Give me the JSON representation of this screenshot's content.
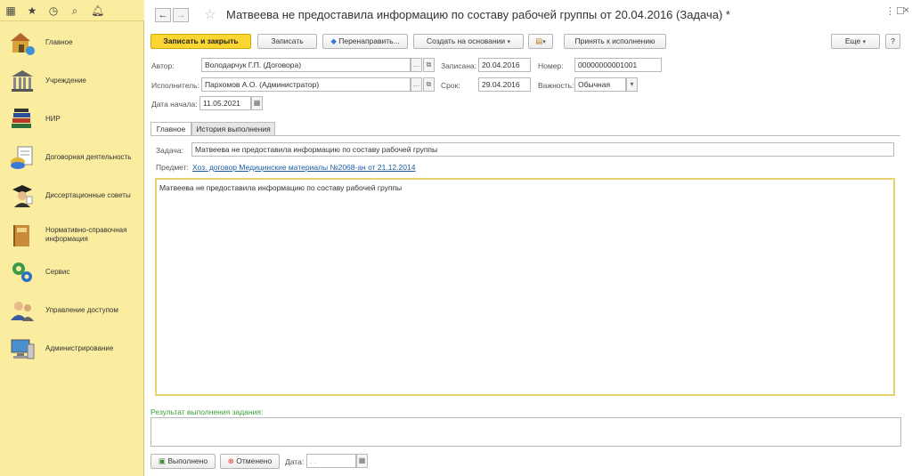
{
  "topbar": {
    "icons": [
      "apps-grid-icon",
      "star-icon",
      "history-icon",
      "search-icon",
      "bell-icon"
    ]
  },
  "sidebar": {
    "items": [
      {
        "label": "Главное",
        "icon": "home-icon"
      },
      {
        "label": "Учреждение",
        "icon": "institution-icon"
      },
      {
        "label": "НИР",
        "icon": "books-icon"
      },
      {
        "label": "Договорная деятельность",
        "icon": "contracts-icon"
      },
      {
        "label": "Диссертационные советы",
        "icon": "graduate-icon"
      },
      {
        "label": "Нормативно-справочная информация",
        "icon": "reference-book-icon"
      },
      {
        "label": "Сервис",
        "icon": "service-gears-icon"
      },
      {
        "label": "Управление доступом",
        "icon": "users-icon"
      },
      {
        "label": "Администрирование",
        "icon": "admin-computer-icon"
      }
    ]
  },
  "header": {
    "title": "Матвеева не предоставила информацию по составу рабочей группы от 20.04.2016 (Задача) *",
    "back": "←",
    "forward": "→",
    "star": "☆"
  },
  "toolbar": {
    "save_close": "Записать и закрыть",
    "save": "Записать",
    "redirect": "Перенаправить...",
    "create_based": "Создать на основании",
    "accept": "Принять к исполнению",
    "more": "Еще",
    "help": "?"
  },
  "form": {
    "author_label": "Автор:",
    "author_value": "Володарчук Г.П. (Договора)",
    "recorded_label": "Записана:",
    "recorded_value": "20.04.2016",
    "number_label": "Номер:",
    "number_value": "00000000001001",
    "executor_label": "Исполнитель:",
    "executor_value": "Пархомов А.О. (Администратор)",
    "deadline_label": "Срок:",
    "deadline_value": "29.04.2016",
    "importance_label": "Важность:",
    "importance_value": "Обычная",
    "start_label": "Дата начала:",
    "start_value": "11.05.2021"
  },
  "tabs": [
    {
      "label": "Главное",
      "active": true
    },
    {
      "label": "История выполнения",
      "active": false
    }
  ],
  "main": {
    "task_label": "Задача:",
    "task_value": "Матвеева не предоставила информацию по составу рабочей группы",
    "subject_label": "Предмет:",
    "subject_link": "Хоз. договор Медицинские материалы №2068-ан от 21.12.2014",
    "description": "Матвеева не предоставила информацию по составу рабочей группы",
    "result_label": "Результат выполнения задания:"
  },
  "footer": {
    "done": "Выполнено",
    "cancelled": "Отменено",
    "date_label": "Дата:",
    "date_placeholder": "  .  ."
  },
  "colors": {
    "sidebar_bg": "#fbeda0",
    "primary_button": "#fbd531",
    "link": "#1a5ea8",
    "result_label": "#3aa13a"
  }
}
